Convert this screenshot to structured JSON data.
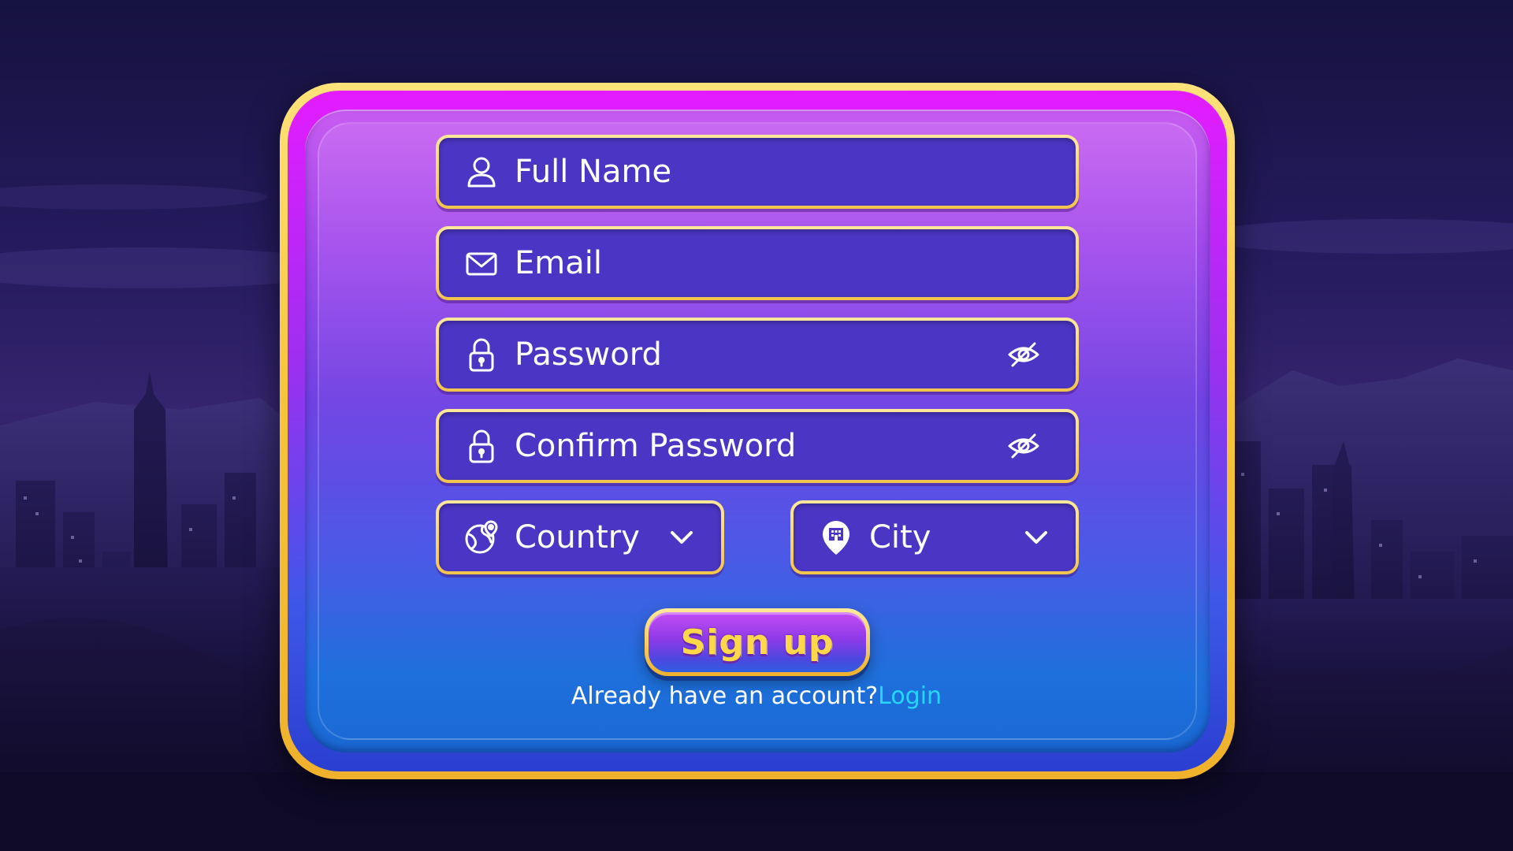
{
  "form": {
    "full_name_placeholder": "Full Name",
    "email_placeholder": "Email",
    "password_placeholder": "Password",
    "confirm_password_placeholder": "Confirm Password",
    "country_label": "Country",
    "city_label": "City"
  },
  "actions": {
    "signup_label": "Sign up",
    "login_prompt": "Already have an account?",
    "login_link": "Login"
  },
  "icons": {
    "full_name": "user-icon",
    "email": "mail-icon",
    "password": "lock-icon",
    "confirm_password": "lock-icon",
    "password_toggle": "eye-off-icon",
    "country": "globe-icon",
    "city": "map-pin-building-icon",
    "dropdown": "chevron-down-icon"
  },
  "colors": {
    "frame_gold": "#f6c43c",
    "panel_top": "#c85cf1",
    "panel_bottom": "#1a68d4",
    "field_fill": "#4b35c4",
    "signup_text": "#ffd84a",
    "login_link": "#27d6ff"
  }
}
